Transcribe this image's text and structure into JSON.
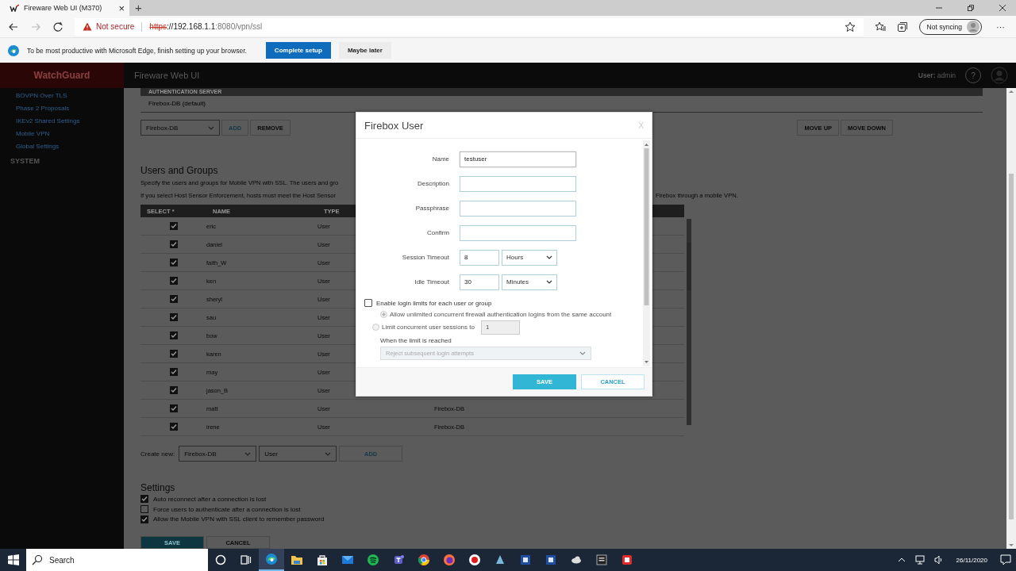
{
  "browser": {
    "tab": {
      "title": "Fireware Web UI (M370)",
      "close": "×"
    },
    "new_tab": "+",
    "address": {
      "security": "Not secure",
      "scheme": "https",
      "host": "://192.168.1.1",
      "path": ":8080/vpn/ssl"
    },
    "profile": "Not syncing",
    "menu": "···"
  },
  "infobar": {
    "message": "To be most productive with Microsoft Edge, finish setting up your browser.",
    "buttons": [
      {
        "label": "Complete setup",
        "primary": true
      },
      {
        "label": "Maybe later",
        "primary": false
      }
    ]
  },
  "app": {
    "logo": "WatchGuard",
    "title": "Fireware Web UI",
    "user_label": "User:",
    "user": "admin",
    "help": "?"
  },
  "sidebar": {
    "items": [
      "BOVPN Over TLS",
      "Phase 2 Proposals",
      "IKEv2 Shared Settings",
      "Mobile VPN",
      "Global Settings"
    ],
    "section": "SYSTEM"
  },
  "auth_servers": {
    "heading": "AUTHENTICATION SERVER",
    "rows": [
      "Firebox-DB (default)"
    ],
    "select": "Firebox-DB",
    "buttons": [
      {
        "label": "ADD",
        "primary": true
      },
      {
        "label": "REMOVE",
        "primary": false
      }
    ],
    "order_buttons": [
      "MOVE UP",
      "MOVE DOWN"
    ]
  },
  "users": {
    "title": "Users and Groups",
    "notes": [
      "Specify the users and groups for Mobile VPN with SSL. The users and gro",
      "If you select Host Sensor Enforcement, hosts must meet the Host Sensor"
    ],
    "note_tail": "Firebox through a mobile VPN.",
    "columns": [
      "SELECT *",
      "NAME",
      "TYPE"
    ],
    "rows": [
      {
        "checked": true,
        "name": "eric",
        "type": "User"
      },
      {
        "checked": true,
        "name": "daniel",
        "type": "User"
      },
      {
        "checked": true,
        "name": "faith_W",
        "type": "User"
      },
      {
        "checked": true,
        "name": "ken",
        "type": "User"
      },
      {
        "checked": true,
        "name": "sheryl",
        "type": "User"
      },
      {
        "checked": true,
        "name": "sau",
        "type": "User"
      },
      {
        "checked": true,
        "name": "bow",
        "type": "User"
      },
      {
        "checked": true,
        "name": "karen",
        "type": "User"
      },
      {
        "checked": true,
        "name": "may",
        "type": "User"
      },
      {
        "checked": true,
        "name": "jason_B",
        "type": "User"
      },
      {
        "checked": true,
        "name": "matt",
        "type": "User",
        "server": "Firebox-DB"
      },
      {
        "checked": true,
        "name": "irene",
        "type": "User",
        "server": "Firebox-DB"
      }
    ]
  },
  "create_new": {
    "label": "Create new:",
    "server": "Firebox-DB",
    "type": "User",
    "button": "ADD"
  },
  "settings": {
    "title": "Settings",
    "options": [
      {
        "label": "Auto reconnect after a connection is lost",
        "checked": true
      },
      {
        "label": "Force users to authenticate after a connection is lost",
        "checked": false
      },
      {
        "label": "Allow the Mobile VPN with SSL client to remember password",
        "checked": true
      }
    ],
    "buttons": [
      {
        "label": "SAVE",
        "primary": true
      },
      {
        "label": "CANCEL",
        "primary": false
      }
    ]
  },
  "dialog": {
    "title": "Firebox User",
    "close": "X",
    "fields": [
      {
        "kind": "text",
        "label": "Name",
        "value": "testuser"
      },
      {
        "kind": "text",
        "label": "Description"
      },
      {
        "kind": "text",
        "label": "Passphrase"
      },
      {
        "kind": "text",
        "label": "Confirm"
      },
      {
        "kind": "timeout",
        "label": "Session Timeout",
        "value": "8",
        "unit": "Hours"
      },
      {
        "kind": "timeout",
        "label": "Idle Timeout",
        "value": "30",
        "unit": "Minutes"
      }
    ],
    "login_limits": {
      "label": "Enable login limits for each user or group",
      "checked": false
    },
    "options": [
      {
        "label": "Allow unlimited concurrent firewall authentication logins from the same account",
        "selected": true
      },
      {
        "label": "Limit concurrent user sessions to",
        "selected": false,
        "value": "1"
      }
    ],
    "limit_note": "When the limit is reached",
    "limit_action": "Reject subsequent login attempts",
    "buttons": [
      {
        "label": "SAVE",
        "primary": true
      },
      {
        "label": "CANCEL",
        "primary": false
      }
    ]
  },
  "taskbar": {
    "search": "Search",
    "apps": [
      {
        "kind": "cortana"
      },
      {
        "kind": "taskview"
      },
      {
        "kind": "edge",
        "selected": true
      },
      {
        "kind": "folder",
        "selected": false
      },
      {
        "kind": "store",
        "selected": false
      },
      {
        "kind": "mail",
        "selected": false
      },
      {
        "kind": "spotify",
        "selected": false
      },
      {
        "kind": "teams",
        "selected": false
      },
      {
        "kind": "chrome",
        "selected": false
      },
      {
        "kind": "firefox",
        "selected": false
      },
      {
        "kind": "record",
        "selected": false
      },
      {
        "kind": "app",
        "selected": false
      },
      {
        "kind": "square",
        "selected": false
      },
      {
        "kind": "square",
        "selected": false
      },
      {
        "kind": "cloud",
        "selected": false
      },
      {
        "kind": "game",
        "selected": false
      },
      {
        "kind": "redapp",
        "selected": false
      }
    ],
    "date": "26/11/2020"
  }
}
